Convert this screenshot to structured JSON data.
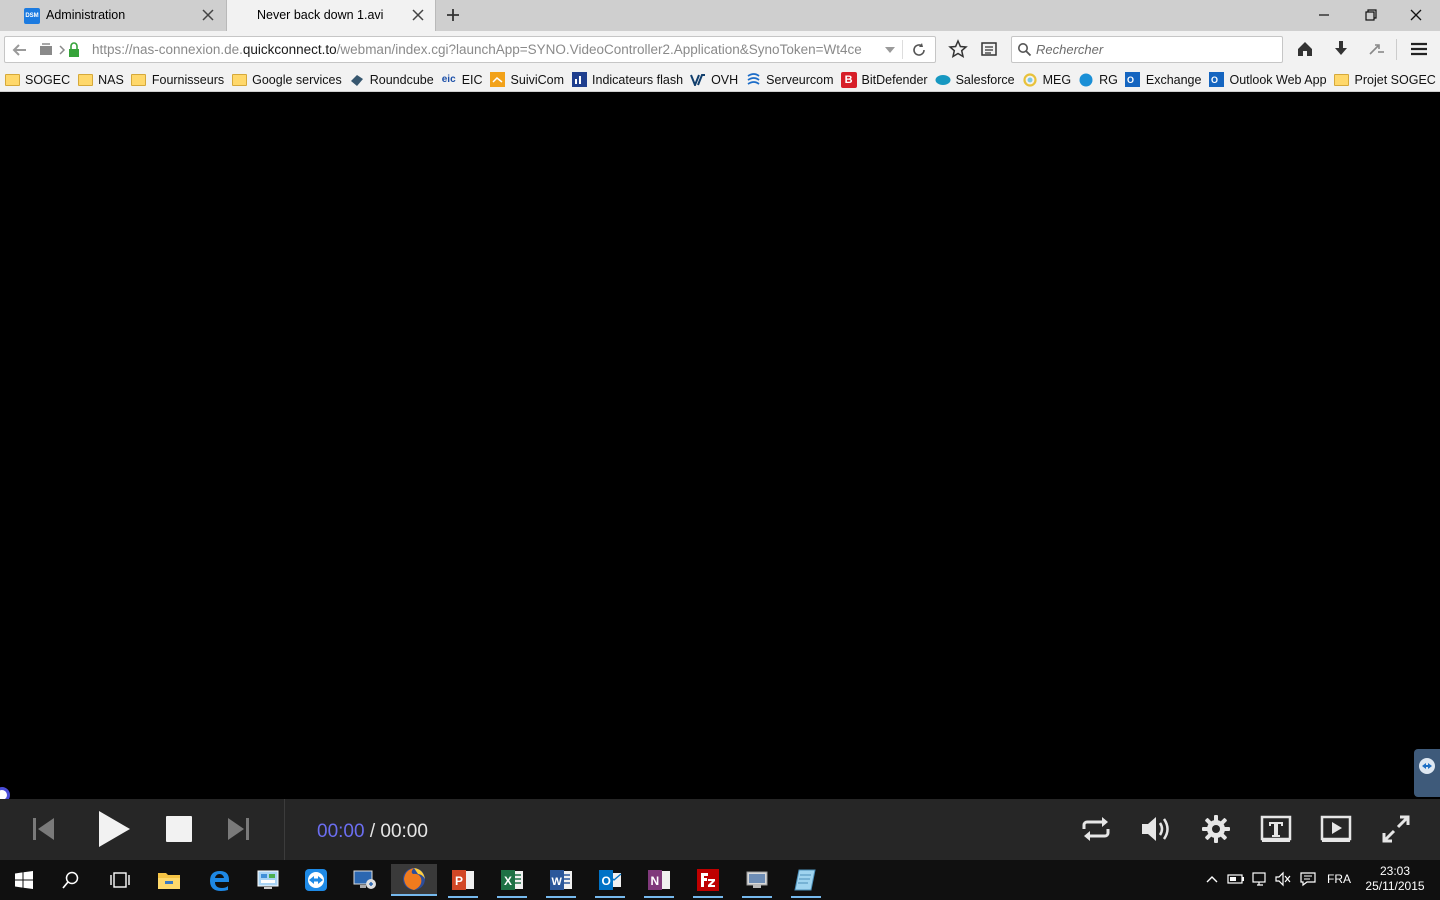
{
  "browser": {
    "tabs": [
      {
        "label": "Administration",
        "favicon_text": "DSM",
        "active": false
      },
      {
        "label": "Never back down 1.avi",
        "active": true
      }
    ],
    "url": {
      "prefix": "https://nas-connexion.de.",
      "host": "quickconnect.to",
      "path": "/webman/index.cgi?launchApp=SYNO.VideoController2.Application&SynoToken=Wt4ce"
    },
    "search": {
      "placeholder": "Rechercher"
    },
    "bookmarks": [
      {
        "label": "SOGEC",
        "icon": "folder-icon"
      },
      {
        "label": "NAS",
        "icon": "folder-icon"
      },
      {
        "label": "Fournisseurs",
        "icon": "folder-icon"
      },
      {
        "label": "Google services",
        "icon": "folder-icon"
      },
      {
        "label": "Roundcube",
        "icon": "roundcube-icon"
      },
      {
        "label": "EIC",
        "icon": "eic-icon"
      },
      {
        "label": "SuiviCom",
        "icon": "suivicom-icon"
      },
      {
        "label": "Indicateurs flash",
        "icon": "indicateurs-icon"
      },
      {
        "label": "OVH",
        "icon": "ovh-icon"
      },
      {
        "label": "Serveurcom",
        "icon": "serveurcom-icon"
      },
      {
        "label": "BitDefender",
        "icon": "bitdefender-icon"
      },
      {
        "label": "Salesforce",
        "icon": "salesforce-icon"
      },
      {
        "label": "MEG",
        "icon": "meg-icon"
      },
      {
        "label": "RG",
        "icon": "rg-icon"
      },
      {
        "label": "Exchange",
        "icon": "outlook-icon"
      },
      {
        "label": "Outlook Web App",
        "icon": "outlook-icon"
      },
      {
        "label": "Projet SOGEC",
        "icon": "folder-icon"
      }
    ]
  },
  "player": {
    "current_time": "00:00",
    "separator": " / ",
    "total_time": "00:00",
    "accent_color": "#6b6ef0"
  },
  "taskbar": {
    "apps": [
      "start-icon",
      "search-icon",
      "task-view-icon",
      "file-explorer-icon",
      "edge-icon",
      "control-panel-icon",
      "teamviewer-icon",
      "remote-desktop-icon",
      "firefox-icon",
      "powerpoint-icon",
      "excel-icon",
      "word-icon",
      "outlook-icon",
      "onenote-icon",
      "filezilla-icon",
      "network-app-icon",
      "notepad-app-icon"
    ],
    "language": "FRA",
    "time": "23:03",
    "date": "25/11/2015"
  }
}
